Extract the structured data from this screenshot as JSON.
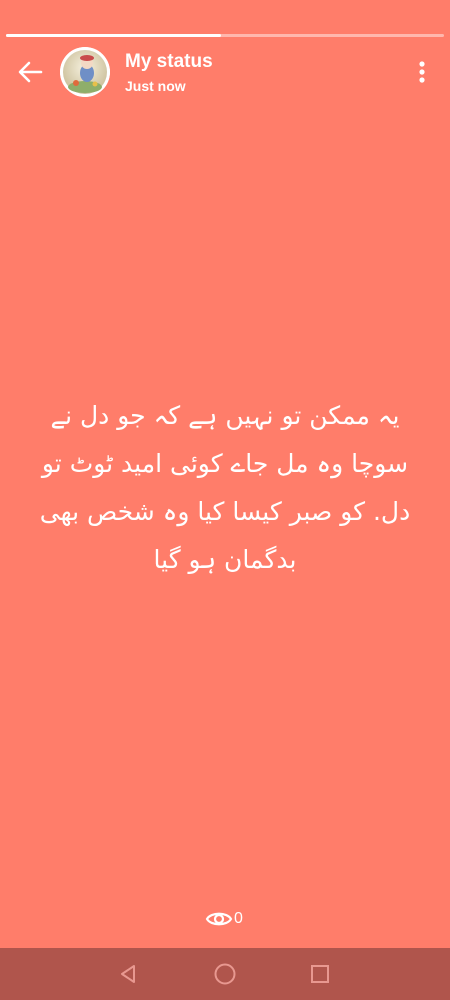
{
  "colors": {
    "background": "#FF7D6A",
    "text": "#FFFFFF",
    "navbar": "#B0554C",
    "nav_icon": "#E89890"
  },
  "progress": {
    "fraction": 0.49
  },
  "header": {
    "title": "My status",
    "subtitle": "Just now",
    "back_icon": "arrow-back-icon",
    "menu_icon": "more-vert-icon"
  },
  "status": {
    "text": "یہ ممکن تو نہیں ہے کہ جو دل نے سوچا وہ مل جاے کوئی امید ٹوٹ تو دل. کو صبر کیسا کیا وہ شخص بھی بدگمان ہو گیا"
  },
  "footer": {
    "views_icon": "eye-icon",
    "views_count": "0"
  },
  "navbar": {
    "back_icon": "nav-back-triangle-icon",
    "home_icon": "nav-home-circle-icon",
    "recents_icon": "nav-recents-square-icon"
  }
}
